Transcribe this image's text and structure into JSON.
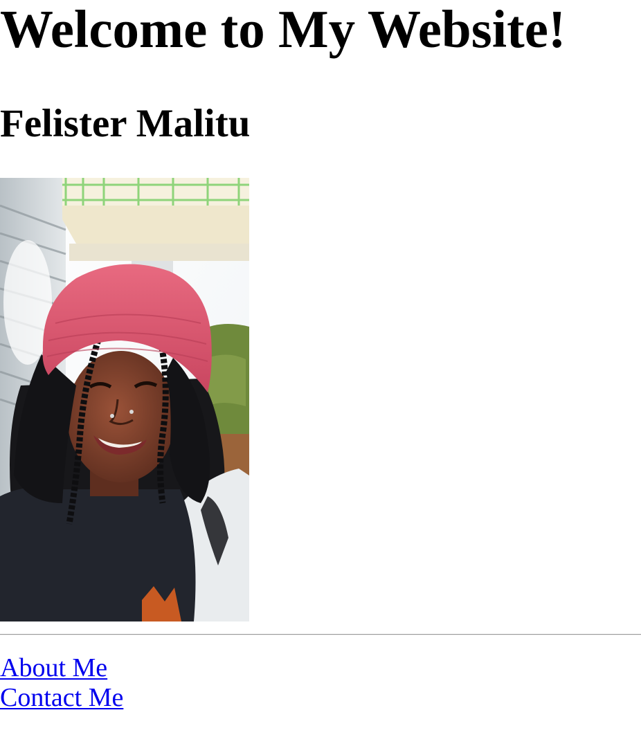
{
  "page": {
    "title": "Welcome to My Website!",
    "name": "Felister Malitu"
  },
  "photo": {
    "alt": "Felister Malitu",
    "colors": {
      "wall": "#d8dde0",
      "balcony": "#f4eedd",
      "railing": "#8fd47a",
      "hedge": "#6f8a3c",
      "beanie": "#e0566e",
      "skin": "#7a3f2b",
      "hair": "#17171a",
      "sweater": "#22252d",
      "accent": "#c85a22"
    }
  },
  "nav": {
    "about": "About Me",
    "contact": "Contact Me"
  },
  "colors": {
    "link": "#0000ee",
    "text": "#000000",
    "background": "#ffffff"
  }
}
